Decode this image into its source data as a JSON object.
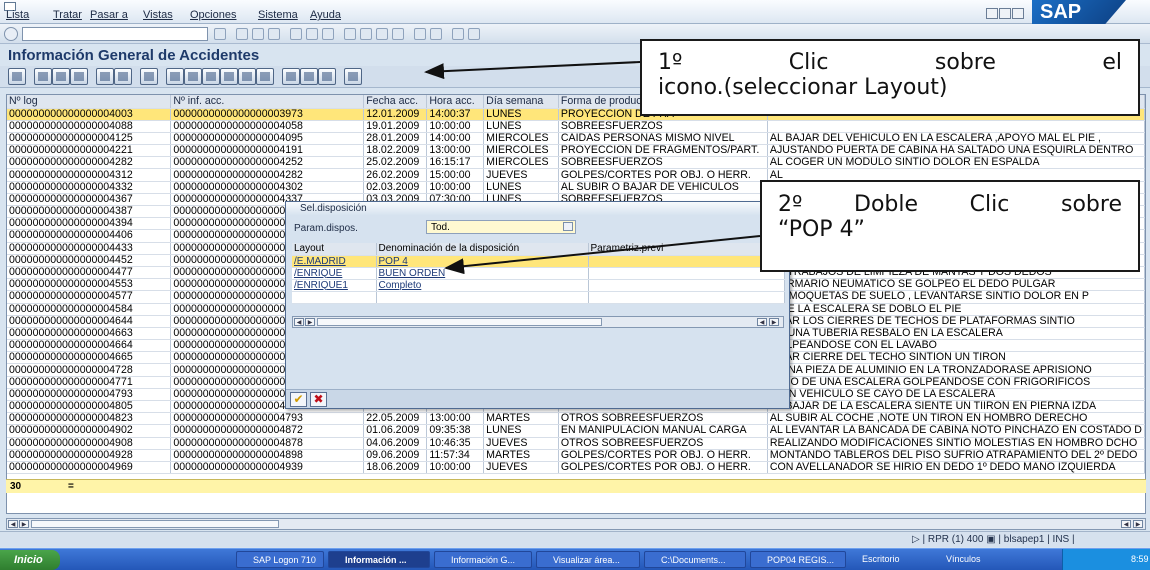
{
  "menu": [
    "Lista",
    "Tratar",
    "Pasar a",
    "Vistas",
    "Opciones",
    "Sistema",
    "Ayuda"
  ],
  "logo": "SAP",
  "title": "Información General de Accidentes",
  "columns": [
    "Nº log",
    "Nº inf. acc.",
    "Fecha acc.",
    "Hora acc.",
    "Día semana",
    "Forma de producirse"
  ],
  "rows": [
    [
      "000000000000000004003",
      "0000000000000000003973",
      "12.01.2009",
      "14:00:37",
      "LUNES",
      "PROYECCIÓN DE FRA",
      ""
    ],
    [
      "000000000000000004088",
      "0000000000000000004058",
      "19.01.2009",
      "10:00:00",
      "LUNES",
      "SOBREESFUERZOS",
      ""
    ],
    [
      "000000000000000004125",
      "0000000000000000004095",
      "28.01.2009",
      "14:00:00",
      "MIÉRCOLES",
      "CAÍDAS PERSONAS MISMO NIVEL",
      "AL BAJAR DEL VEHICULO EN LA ESCALERA ,APOYO MAL EL PIE ,"
    ],
    [
      "000000000000000004221",
      "0000000000000000004191",
      "18.02.2009",
      "13:00:00",
      "MIÉRCOLES",
      "PROYECCIÓN DE FRAGMENTOS/PART.",
      "AJUSTANDO PUERTA DE CABINA HA SALTADO UNA ESQUIRLA DENTRO"
    ],
    [
      "000000000000000004282",
      "0000000000000000004252",
      "25.02.2009",
      "16:15:17",
      "MIÉRCOLES",
      "SOBREESFUERZOS",
      "AL COGER UN MODULO  SINTIO  DOLOR EN ESPALDA"
    ],
    [
      "000000000000000004312",
      "0000000000000000004282",
      "26.02.2009",
      "15:00:00",
      "JUEVES",
      "GOLPES/CORTES POR OBJ. O HERR.",
      "AL"
    ],
    [
      "000000000000000004332",
      "0000000000000000004302",
      "02.03.2009",
      "10:00:00",
      "LUNES",
      "AL SUBIR O BAJAR DE VEHICULOS",
      "AL"
    ],
    [
      "000000000000000004367",
      "0000000000000000004337",
      "03.03.2009",
      "07:30:00",
      "LUNES",
      "SOBREESFUERZOS",
      ""
    ],
    [
      "000000000000000004387",
      "000000000000000000043",
      "",
      "",
      "",
      "",
      ""
    ],
    [
      "000000000000000004394",
      "000000000000000000043",
      "",
      "",
      "",
      "",
      ""
    ],
    [
      "000000000000000004406",
      "000000000000000000043",
      "",
      "",
      "",
      "",
      ""
    ],
    [
      "000000000000000004433",
      "000000000000000000044",
      "",
      "",
      "",
      "",
      ""
    ],
    [
      "000000000000000004452",
      "000000000000000000044",
      "",
      "",
      "",
      "",
      ""
    ],
    [
      "000000000000000004477",
      "000000000000000000044",
      "",
      "",
      "",
      "",
      "DE TRABAJOS DE LIMPIEZA DE MANTAS Y DOS DEDOS"
    ],
    [
      "000000000000000004553",
      "000000000000000000045",
      "",
      "",
      "",
      "",
      "R ARMARIO NEUMATICO SE GOLPEO EL DEDO PULGAR"
    ],
    [
      "000000000000000004577",
      "000000000000000000045",
      "",
      "",
      "",
      "",
      "DO MOQUETAS DE SUELO , LEVANTARSE SINTIO DOLOR EN P"
    ],
    [
      "000000000000000004584",
      "000000000000000000045",
      "",
      "",
      "",
      "",
      "E DE LA ESCALERA SE DOBLÓ EL PIE"
    ],
    [
      "000000000000000004644",
      "000000000000000000046",
      "",
      "",
      "",
      "",
      "OBAR LOS CIERRES DE TECHOS DE PLATAFORMAS SINTIO"
    ],
    [
      "000000000000000004663",
      "000000000000000000046",
      "",
      "",
      "",
      "",
      "AR UNA TUBERIA RESBALO EN LA ESCALERA"
    ],
    [
      "000000000000000004664",
      "000000000000000000046",
      "",
      "",
      "",
      "",
      "GOLPEANDOSE CON EL LAVABO"
    ],
    [
      "000000000000000004665",
      "000000000000000000046",
      "",
      "",
      "",
      "",
      "OBAR CIERRE DEL TECHO SINTION UN TIRON"
    ],
    [
      "000000000000000004728",
      "000000000000000000046",
      "",
      "",
      "",
      "",
      "R UNA PIEZA DE ALUMINIO EN LA TRONZADORASE APRISIONO"
    ],
    [
      "000000000000000004771",
      "000000000000000000047",
      "",
      "",
      "",
      "",
      "LADO DE UNA ESCALERA GOLPEANDOSE CON FRIGORIFICOS"
    ],
    [
      "000000000000000004793",
      "000000000000000000047",
      "",
      "",
      "",
      "",
      "O UN VEHICULO SE CAYO DE LA ESCALERA"
    ],
    [
      "000000000000000004805",
      "0000000000000000004775",
      "25.05.2009",
      "07:30:00",
      "LUNES",
      "OTROS SOBREESFUERZOS",
      "AL BAJAR DE LA ESCALERA SIENTE UN TIIRON EN PIERNA IZDA"
    ],
    [
      "000000000000000004823",
      "0000000000000000004793",
      "22.05.2009",
      "13:00:00",
      "MARTES",
      "OTROS SOBREESFUERZOS",
      "AL SUBIR AL COCHE ,NOTE UN TIRON EN HOMBRO DERECHO"
    ],
    [
      "000000000000000004902",
      "0000000000000000004872",
      "01.06.2009",
      "09:35:38",
      "LUNES",
      "EN MANIPULACION MANUAL CARGA",
      "AL LEVANTAR LA BANCADA DE CABINA NOTO PINCHAZO EN COSTADO D"
    ],
    [
      "000000000000000004908",
      "0000000000000000004878",
      "04.06.2009",
      "10:46:35",
      "JUEVES",
      "OTROS SOBREESFUERZOS",
      "REALIZANDO MODIFICACIONES SINTIO MOLESTIAS EN HOMBRO DCHO"
    ],
    [
      "000000000000000004928",
      "0000000000000000004898",
      "09.06.2009",
      "11:57:34",
      "MARTES",
      "GOLPES/CORTES POR OBJ. O HERR.",
      "MONTANDO TABLEROS DEL PISO SUFRIO ATRAPAMIENTO DEL 2º DEDO"
    ],
    [
      "000000000000000004969",
      "0000000000000000004939",
      "18.06.2009",
      "10:00:00",
      "JUEVES",
      "GOLPES/CORTES POR OBJ. O HERR.",
      "CON AVELLANADOR SE HIRIO EN DEDO 1º DEDO MANO IZQUIERDA"
    ]
  ],
  "total_count": "30",
  "total_marker": "=",
  "dialog": {
    "title": "Sel.disposición",
    "param_label": "Param.dispos.",
    "param_value": "Tod.",
    "headers": [
      "Layout",
      "Denominación de la disposición",
      "Parametriz.previ"
    ],
    "rows": [
      [
        "/E.MADRID",
        "POP 4"
      ],
      [
        "/ENRIQUE",
        "BUEN ORDEN"
      ],
      [
        "/ENRIQUE1",
        "Completo"
      ]
    ]
  },
  "callout1": {
    "line1": [
      "1º",
      "Clic",
      "sobre",
      "el"
    ],
    "line2": "icono.(seleccionar Layout)"
  },
  "callout2": {
    "line1": [
      "2º",
      "Doble",
      "Clic",
      "sobre"
    ],
    "line2": "“POP 4”"
  },
  "status": "▷ | RPR (1) 400 ▣ | blsapep1 | INS |",
  "taskbar": {
    "start": "Inicio",
    "items": [
      "SAP Logon 710",
      "Información ...",
      "Información G...",
      "Visualizar área...",
      "C:\\Documents...",
      "POP04 REGIS..."
    ],
    "escritorio": "Escritorio",
    "vinculos": "Vínculos",
    "clock": "8:59"
  }
}
